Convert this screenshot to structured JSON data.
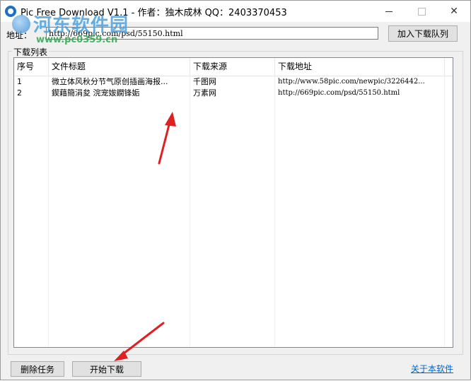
{
  "window": {
    "title": "Pic Free Download V1.1 - 作者：独木成林 QQ：2403370453"
  },
  "watermark": {
    "text": "河东软件园",
    "url": "www.pc0359.cn"
  },
  "address": {
    "label": "地址：",
    "value": "http://669pic.com/psd/55150.html"
  },
  "buttons": {
    "add_to_queue": "加入下载队列",
    "delete_task": "删除任务",
    "start_download": "开始下载"
  },
  "group": {
    "title": "下载列表"
  },
  "table": {
    "columns": [
      "序号",
      "文件标题",
      "下载来源",
      "下载地址"
    ],
    "rows": [
      [
        "1",
        "微立体风秋分节气原创插画海报...",
        "千图网",
        "http://www.58pic.com/newpic/3226442..."
      ],
      [
        "2",
        "鍥藉簡涓夋  浣宠妭鐗锋姤",
        "万素网",
        "http://669pic.com/psd/55150.html"
      ]
    ]
  },
  "footer": {
    "about_link": "关于本软件"
  },
  "colors": {
    "accent": "#1d6fc9",
    "link": "#0066cc",
    "arrow": "#e02020"
  }
}
